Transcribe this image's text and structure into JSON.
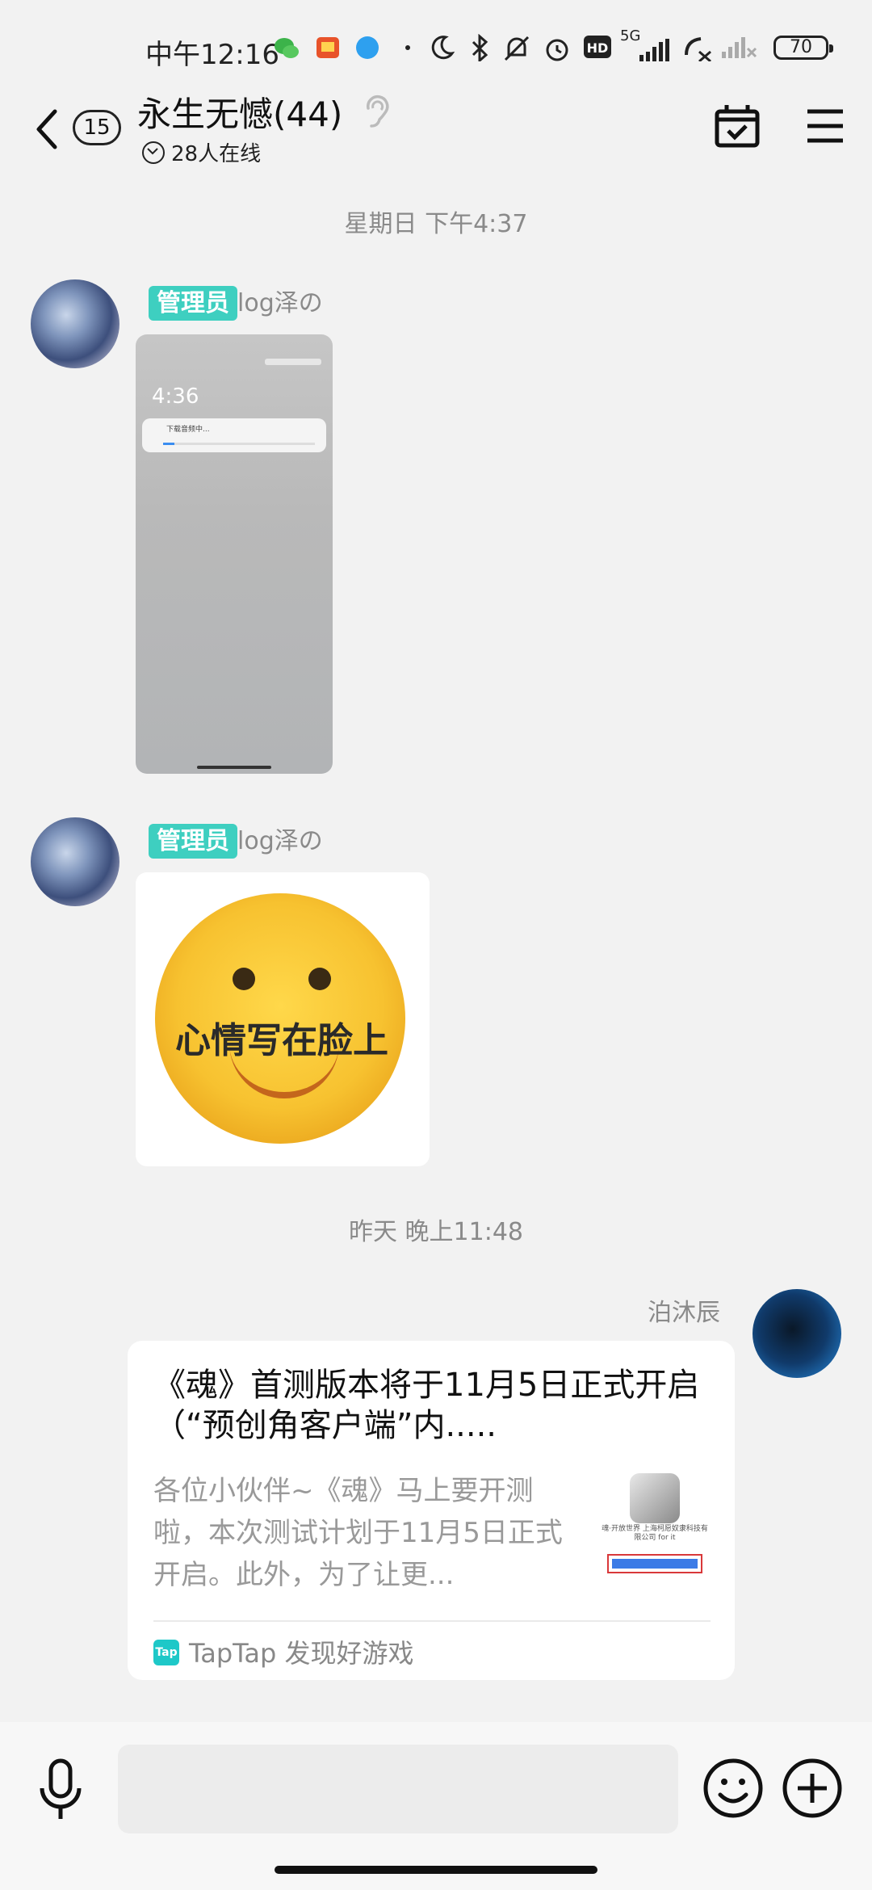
{
  "status_bar": {
    "time": "中午12:16",
    "network": "5G",
    "battery": "70"
  },
  "header": {
    "unread_count": "15",
    "title": "永生无憾(44)",
    "online": "28人在线"
  },
  "messages": [
    {
      "timestamp": "星期日 下午4:37",
      "role": "管理员",
      "sender": "log泽の",
      "image_time": "4:36",
      "notif_text": "下载音频中..."
    },
    {
      "role": "管理员",
      "sender": "log泽の",
      "sticker_caption": "心情写在脸上"
    },
    {
      "timestamp": "昨天 晚上11:48",
      "sender": "泊沐辰",
      "card": {
        "title": "《魂》首测版本将于11月5日正式开启（“预创角客户端”内.....",
        "description": "各位小伙伴~《魂》马上要开测啦，本次测试计划于11月5日正式开启。此外，为了让更...",
        "thumb_text": "魂·开放世界\n上海柯愿奴隶科技有限公司 for it",
        "source": "TapTap 发现好游戏",
        "source_logo": "Tap"
      }
    }
  ],
  "input": {
    "placeholder": ""
  },
  "colors": {
    "role_badge": "#3ecfc0",
    "background": "#f2f2f2",
    "taptap": "#1ec8c8"
  }
}
